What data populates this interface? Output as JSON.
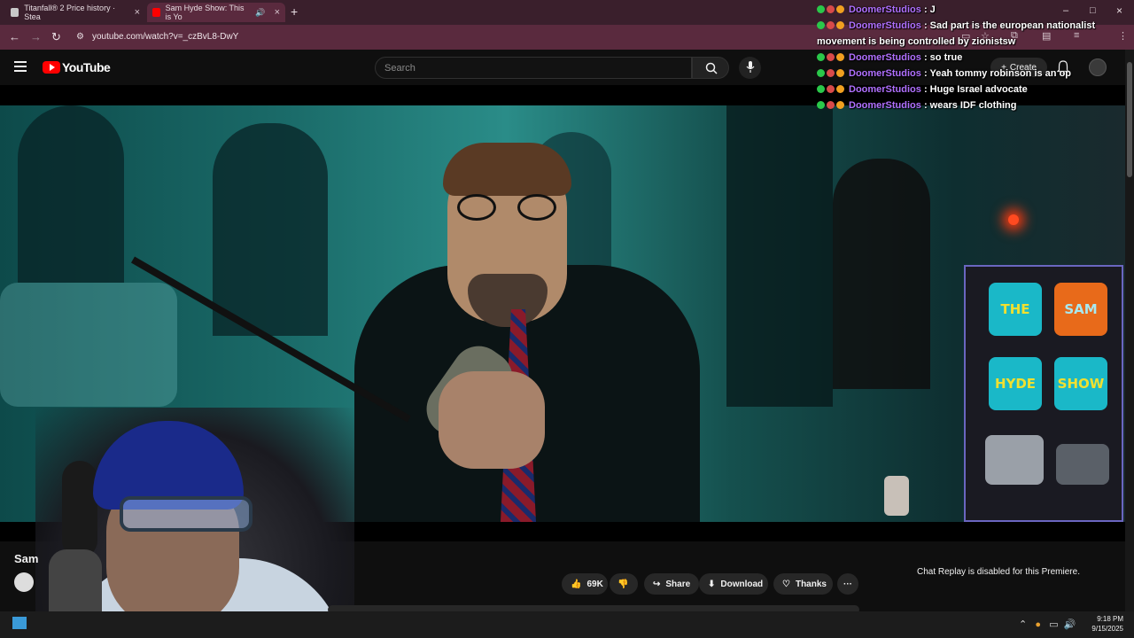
{
  "browser": {
    "tabs": [
      {
        "label": "Titanfall® 2 Price history · Stea",
        "favicon_color": "#c8c8c8"
      },
      {
        "label": "Sam Hyde Show: This is Yo",
        "favicon_color": "#ff0000"
      }
    ],
    "tab_close": "×",
    "new_tab": "+",
    "url": "youtube.com/watch?v=_czBvL8-DwY",
    "window_controls": [
      "–",
      "□",
      "×"
    ]
  },
  "youtube": {
    "logo_text": "YouTube",
    "search_placeholder": "Search",
    "create_label": "Create",
    "create_plus": "+"
  },
  "video": {
    "tv_screens": [
      {
        "text": "THE",
        "bg": "#1ab8c8",
        "fg": "#f0e030"
      },
      {
        "text": "SAM",
        "bg": "#e86a1a",
        "fg": "#a8e8f0"
      },
      {
        "text": "HYDE",
        "bg": "#1ab8c8",
        "fg": "#f0e030"
      },
      {
        "text": "SHOW",
        "bg": "#1ab8c8",
        "fg": "#f0e030"
      }
    ]
  },
  "below_video": {
    "title_visible": "Sam",
    "like_count": "69K",
    "share_label": "Share",
    "download_label": "Download",
    "thanks_label": "Thanks",
    "more_label": "···",
    "chat_replay_text": "Chat Replay is disabled for this Premiere."
  },
  "chat": {
    "messages": [
      {
        "user": "DoomerStudios",
        "text": " : J"
      },
      {
        "user": "DoomerStudios",
        "text": " : Sad part is the european nationalist movement is being controlled by zionistsw"
      },
      {
        "user": "DoomerStudios",
        "text": " : so true"
      },
      {
        "user": "DoomerStudios",
        "text": " : Yeah tommy robinson is an op"
      },
      {
        "user": "DoomerStudios",
        "text": " : Huge Israel advocate"
      },
      {
        "user": "DoomerStudios",
        "text": " : wears IDF clothing"
      }
    ],
    "badge_colors": [
      "#2ac84a",
      "#d84a4a",
      "#f0a020"
    ]
  },
  "taskbar": {
    "time": "9:18 PM",
    "date": "9/15/2025"
  }
}
